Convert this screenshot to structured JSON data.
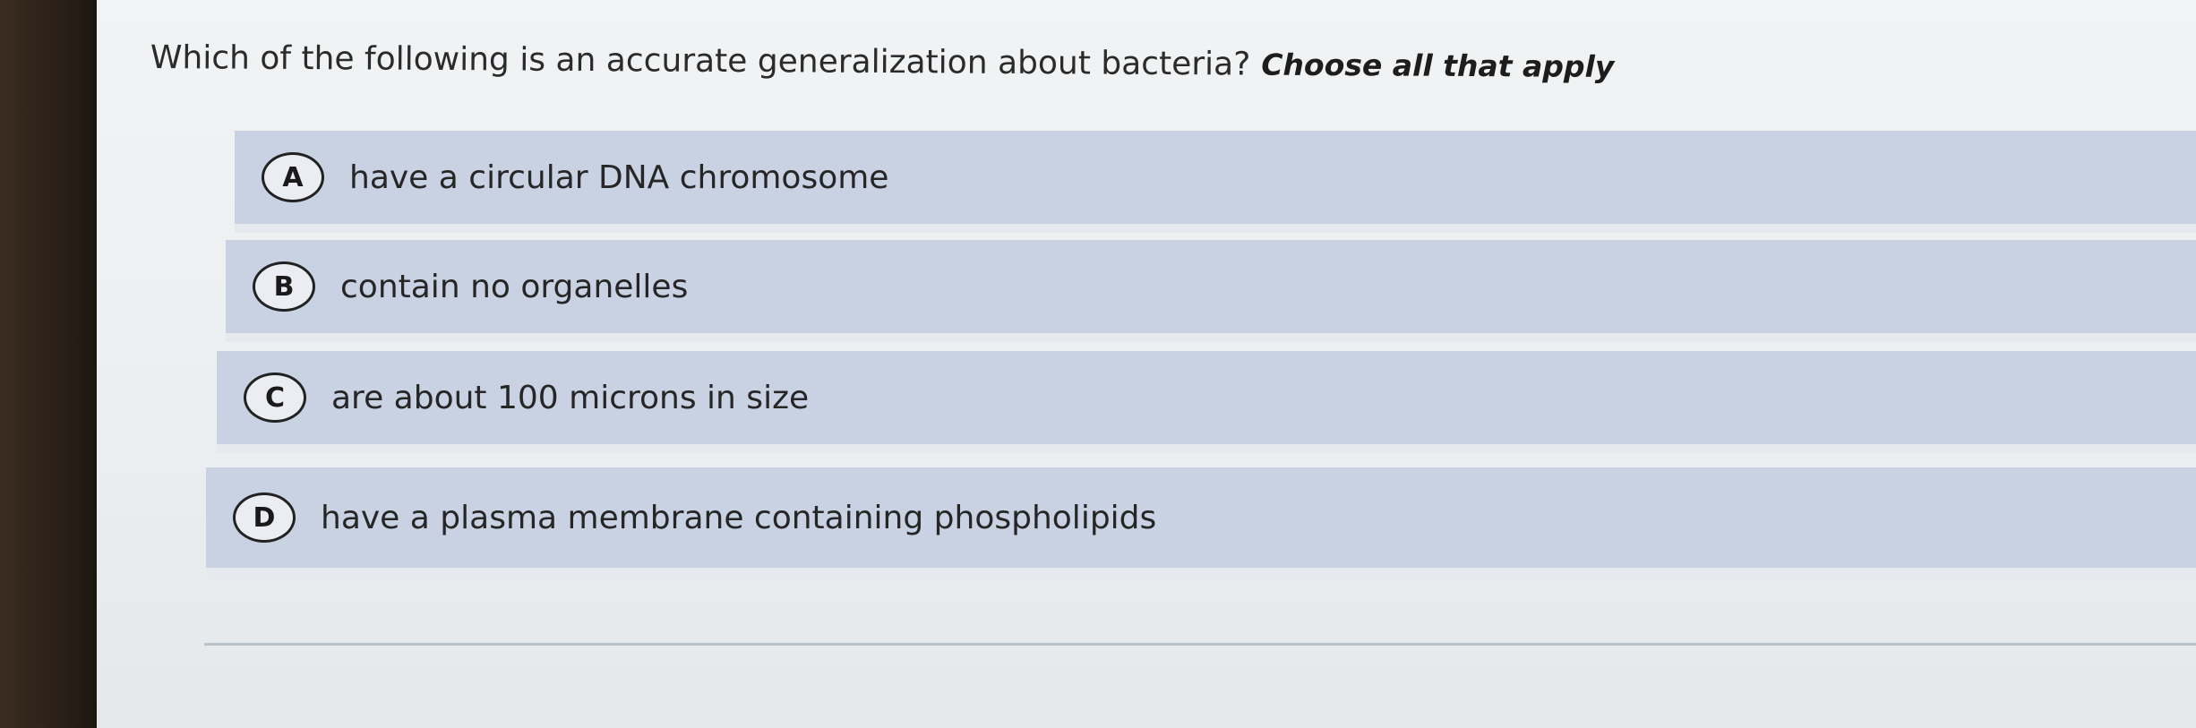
{
  "question": {
    "text": "Which of the following is an accurate generalization about bacteria?",
    "instruction": "Choose all that apply"
  },
  "options": [
    {
      "letter": "A",
      "text": "have a circular DNA chromosome"
    },
    {
      "letter": "B",
      "text": "contain no organelles"
    },
    {
      "letter": "C",
      "text": "are about 100 microns in size"
    },
    {
      "letter": "D",
      "text": "have a plasma membrane containing phospholipids"
    }
  ],
  "colors": {
    "option_background": "#c9d2e2",
    "page_background": "#eceff1",
    "bezel": "#1c1712"
  }
}
